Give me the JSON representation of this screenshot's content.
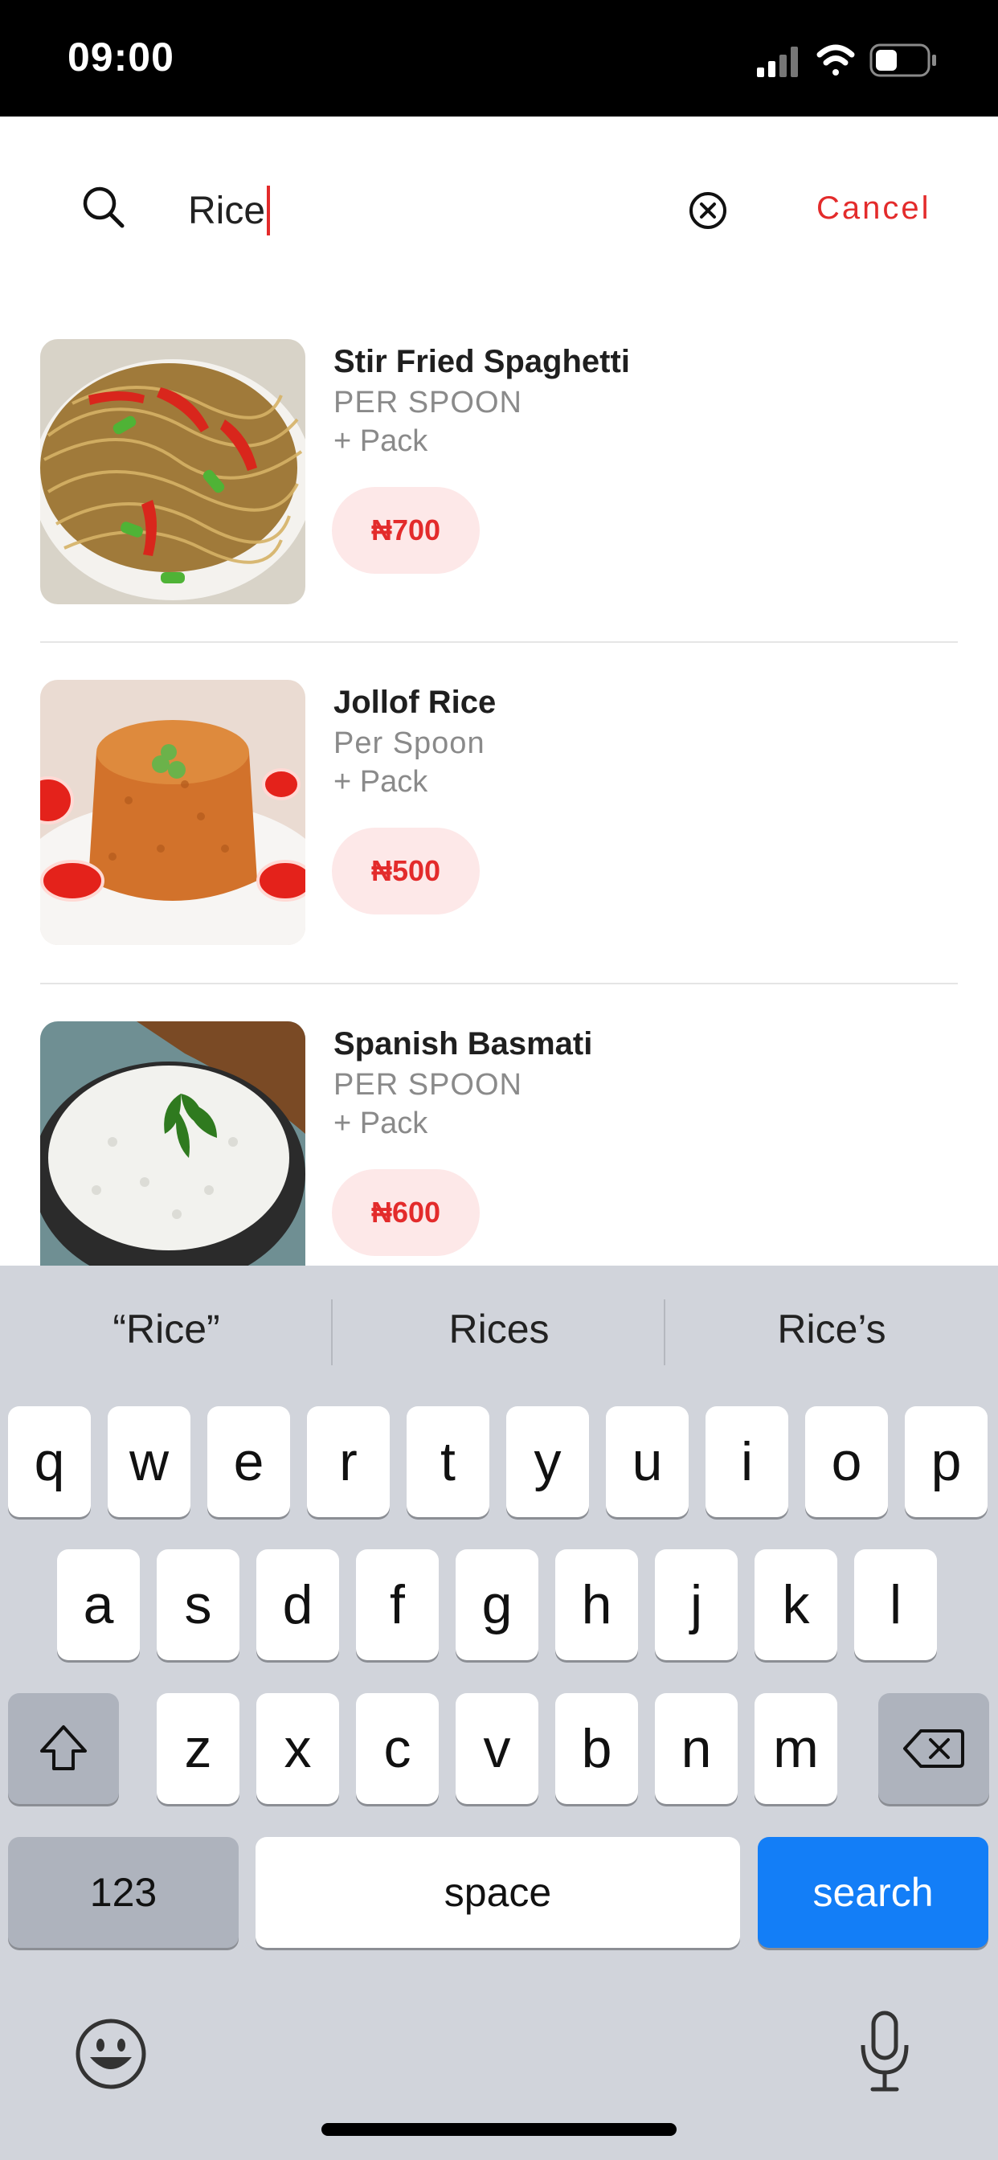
{
  "status_bar": {
    "time": "09:00",
    "icons": [
      "signal-icon",
      "wifi-icon",
      "battery-icon"
    ]
  },
  "search": {
    "query": "Rice",
    "cancel_label": "Cancel"
  },
  "results": [
    {
      "title": "Stir Fried Spaghetti",
      "unit": "PER SPOON",
      "pack": "+ Pack",
      "price": "₦700"
    },
    {
      "title": "Jollof Rice",
      "unit": "Per Spoon",
      "pack": "+ Pack",
      "price": "₦500"
    },
    {
      "title": "Spanish Basmati",
      "unit": "PER SPOON",
      "pack": "+ Pack",
      "price": "₦600"
    }
  ],
  "keyboard": {
    "suggestions": [
      "“Rice”",
      "Rices",
      "Rice’s"
    ],
    "row1": [
      "q",
      "w",
      "e",
      "r",
      "t",
      "y",
      "u",
      "i",
      "o",
      "p"
    ],
    "row2": [
      "a",
      "s",
      "d",
      "f",
      "g",
      "h",
      "j",
      "k",
      "l"
    ],
    "row3": [
      "z",
      "x",
      "c",
      "v",
      "b",
      "n",
      "m"
    ],
    "numbers_label": "123",
    "space_label": "space",
    "search_label": "search",
    "icons": [
      "shift-icon",
      "backspace-icon",
      "emoji-icon",
      "microphone-icon"
    ]
  },
  "colors": {
    "accent": "#e32b2b",
    "price_bg": "#fde8e8",
    "search_key": "#137ef7"
  }
}
